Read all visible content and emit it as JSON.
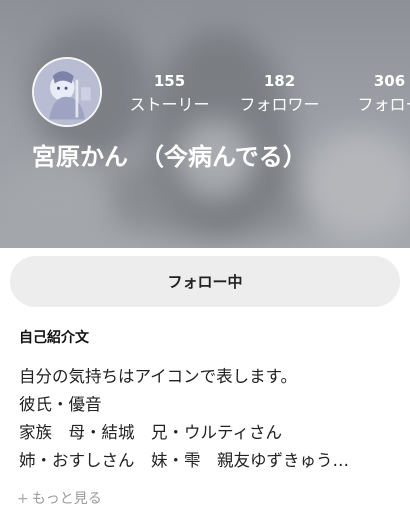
{
  "profile": {
    "name": "宮原かん　（今病んでる）",
    "stats": [
      {
        "count": "155",
        "label": "ストーリー"
      },
      {
        "count": "182",
        "label": "フォロワー"
      },
      {
        "count": "306",
        "label": "フォロー"
      }
    ]
  },
  "actions": {
    "follow_label": "フォロー中"
  },
  "bio": {
    "title": "自己紹介文",
    "lines": [
      "自分の気持ちはアイコンで表します。",
      "彼氏・優音",
      "家族　母・結城　兄・ウルティさん",
      "姉・おすしさん　妹・雫　親友ゆずきゅう…"
    ],
    "more_label": "もっと見る",
    "more_icon": "plus-icon"
  },
  "colors": {
    "button_bg": "#ededed",
    "muted_text": "#9a9a9a"
  }
}
